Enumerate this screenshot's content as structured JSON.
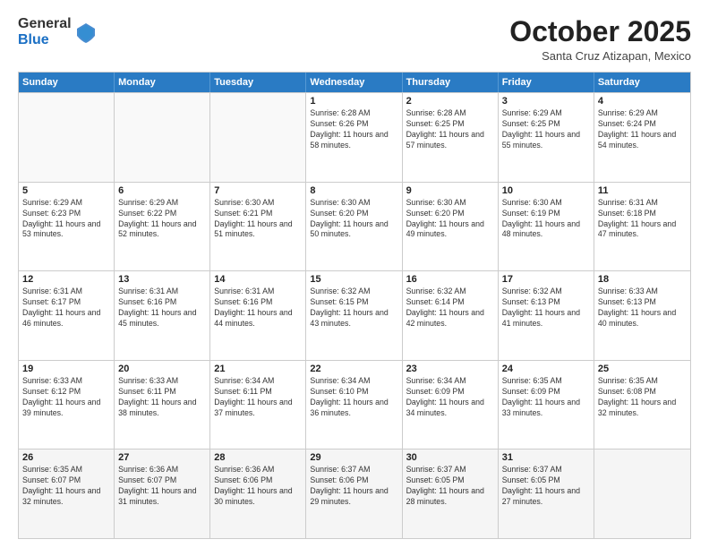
{
  "logo": {
    "general": "General",
    "blue": "Blue"
  },
  "title": "October 2025",
  "location": "Santa Cruz Atizapan, Mexico",
  "days": [
    "Sunday",
    "Monday",
    "Tuesday",
    "Wednesday",
    "Thursday",
    "Friday",
    "Saturday"
  ],
  "weeks": [
    [
      {
        "date": "",
        "sunrise": "",
        "sunset": "",
        "daylight": ""
      },
      {
        "date": "",
        "sunrise": "",
        "sunset": "",
        "daylight": ""
      },
      {
        "date": "",
        "sunrise": "",
        "sunset": "",
        "daylight": ""
      },
      {
        "date": "1",
        "sunrise": "Sunrise: 6:28 AM",
        "sunset": "Sunset: 6:26 PM",
        "daylight": "Daylight: 11 hours and 58 minutes."
      },
      {
        "date": "2",
        "sunrise": "Sunrise: 6:28 AM",
        "sunset": "Sunset: 6:25 PM",
        "daylight": "Daylight: 11 hours and 57 minutes."
      },
      {
        "date": "3",
        "sunrise": "Sunrise: 6:29 AM",
        "sunset": "Sunset: 6:25 PM",
        "daylight": "Daylight: 11 hours and 55 minutes."
      },
      {
        "date": "4",
        "sunrise": "Sunrise: 6:29 AM",
        "sunset": "Sunset: 6:24 PM",
        "daylight": "Daylight: 11 hours and 54 minutes."
      }
    ],
    [
      {
        "date": "5",
        "sunrise": "Sunrise: 6:29 AM",
        "sunset": "Sunset: 6:23 PM",
        "daylight": "Daylight: 11 hours and 53 minutes."
      },
      {
        "date": "6",
        "sunrise": "Sunrise: 6:29 AM",
        "sunset": "Sunset: 6:22 PM",
        "daylight": "Daylight: 11 hours and 52 minutes."
      },
      {
        "date": "7",
        "sunrise": "Sunrise: 6:30 AM",
        "sunset": "Sunset: 6:21 PM",
        "daylight": "Daylight: 11 hours and 51 minutes."
      },
      {
        "date": "8",
        "sunrise": "Sunrise: 6:30 AM",
        "sunset": "Sunset: 6:20 PM",
        "daylight": "Daylight: 11 hours and 50 minutes."
      },
      {
        "date": "9",
        "sunrise": "Sunrise: 6:30 AM",
        "sunset": "Sunset: 6:20 PM",
        "daylight": "Daylight: 11 hours and 49 minutes."
      },
      {
        "date": "10",
        "sunrise": "Sunrise: 6:30 AM",
        "sunset": "Sunset: 6:19 PM",
        "daylight": "Daylight: 11 hours and 48 minutes."
      },
      {
        "date": "11",
        "sunrise": "Sunrise: 6:31 AM",
        "sunset": "Sunset: 6:18 PM",
        "daylight": "Daylight: 11 hours and 47 minutes."
      }
    ],
    [
      {
        "date": "12",
        "sunrise": "Sunrise: 6:31 AM",
        "sunset": "Sunset: 6:17 PM",
        "daylight": "Daylight: 11 hours and 46 minutes."
      },
      {
        "date": "13",
        "sunrise": "Sunrise: 6:31 AM",
        "sunset": "Sunset: 6:16 PM",
        "daylight": "Daylight: 11 hours and 45 minutes."
      },
      {
        "date": "14",
        "sunrise": "Sunrise: 6:31 AM",
        "sunset": "Sunset: 6:16 PM",
        "daylight": "Daylight: 11 hours and 44 minutes."
      },
      {
        "date": "15",
        "sunrise": "Sunrise: 6:32 AM",
        "sunset": "Sunset: 6:15 PM",
        "daylight": "Daylight: 11 hours and 43 minutes."
      },
      {
        "date": "16",
        "sunrise": "Sunrise: 6:32 AM",
        "sunset": "Sunset: 6:14 PM",
        "daylight": "Daylight: 11 hours and 42 minutes."
      },
      {
        "date": "17",
        "sunrise": "Sunrise: 6:32 AM",
        "sunset": "Sunset: 6:13 PM",
        "daylight": "Daylight: 11 hours and 41 minutes."
      },
      {
        "date": "18",
        "sunrise": "Sunrise: 6:33 AM",
        "sunset": "Sunset: 6:13 PM",
        "daylight": "Daylight: 11 hours and 40 minutes."
      }
    ],
    [
      {
        "date": "19",
        "sunrise": "Sunrise: 6:33 AM",
        "sunset": "Sunset: 6:12 PM",
        "daylight": "Daylight: 11 hours and 39 minutes."
      },
      {
        "date": "20",
        "sunrise": "Sunrise: 6:33 AM",
        "sunset": "Sunset: 6:11 PM",
        "daylight": "Daylight: 11 hours and 38 minutes."
      },
      {
        "date": "21",
        "sunrise": "Sunrise: 6:34 AM",
        "sunset": "Sunset: 6:11 PM",
        "daylight": "Daylight: 11 hours and 37 minutes."
      },
      {
        "date": "22",
        "sunrise": "Sunrise: 6:34 AM",
        "sunset": "Sunset: 6:10 PM",
        "daylight": "Daylight: 11 hours and 36 minutes."
      },
      {
        "date": "23",
        "sunrise": "Sunrise: 6:34 AM",
        "sunset": "Sunset: 6:09 PM",
        "daylight": "Daylight: 11 hours and 34 minutes."
      },
      {
        "date": "24",
        "sunrise": "Sunrise: 6:35 AM",
        "sunset": "Sunset: 6:09 PM",
        "daylight": "Daylight: 11 hours and 33 minutes."
      },
      {
        "date": "25",
        "sunrise": "Sunrise: 6:35 AM",
        "sunset": "Sunset: 6:08 PM",
        "daylight": "Daylight: 11 hours and 32 minutes."
      }
    ],
    [
      {
        "date": "26",
        "sunrise": "Sunrise: 6:35 AM",
        "sunset": "Sunset: 6:07 PM",
        "daylight": "Daylight: 11 hours and 32 minutes."
      },
      {
        "date": "27",
        "sunrise": "Sunrise: 6:36 AM",
        "sunset": "Sunset: 6:07 PM",
        "daylight": "Daylight: 11 hours and 31 minutes."
      },
      {
        "date": "28",
        "sunrise": "Sunrise: 6:36 AM",
        "sunset": "Sunset: 6:06 PM",
        "daylight": "Daylight: 11 hours and 30 minutes."
      },
      {
        "date": "29",
        "sunrise": "Sunrise: 6:37 AM",
        "sunset": "Sunset: 6:06 PM",
        "daylight": "Daylight: 11 hours and 29 minutes."
      },
      {
        "date": "30",
        "sunrise": "Sunrise: 6:37 AM",
        "sunset": "Sunset: 6:05 PM",
        "daylight": "Daylight: 11 hours and 28 minutes."
      },
      {
        "date": "31",
        "sunrise": "Sunrise: 6:37 AM",
        "sunset": "Sunset: 6:05 PM",
        "daylight": "Daylight: 11 hours and 27 minutes."
      },
      {
        "date": "",
        "sunrise": "",
        "sunset": "",
        "daylight": ""
      }
    ]
  ]
}
